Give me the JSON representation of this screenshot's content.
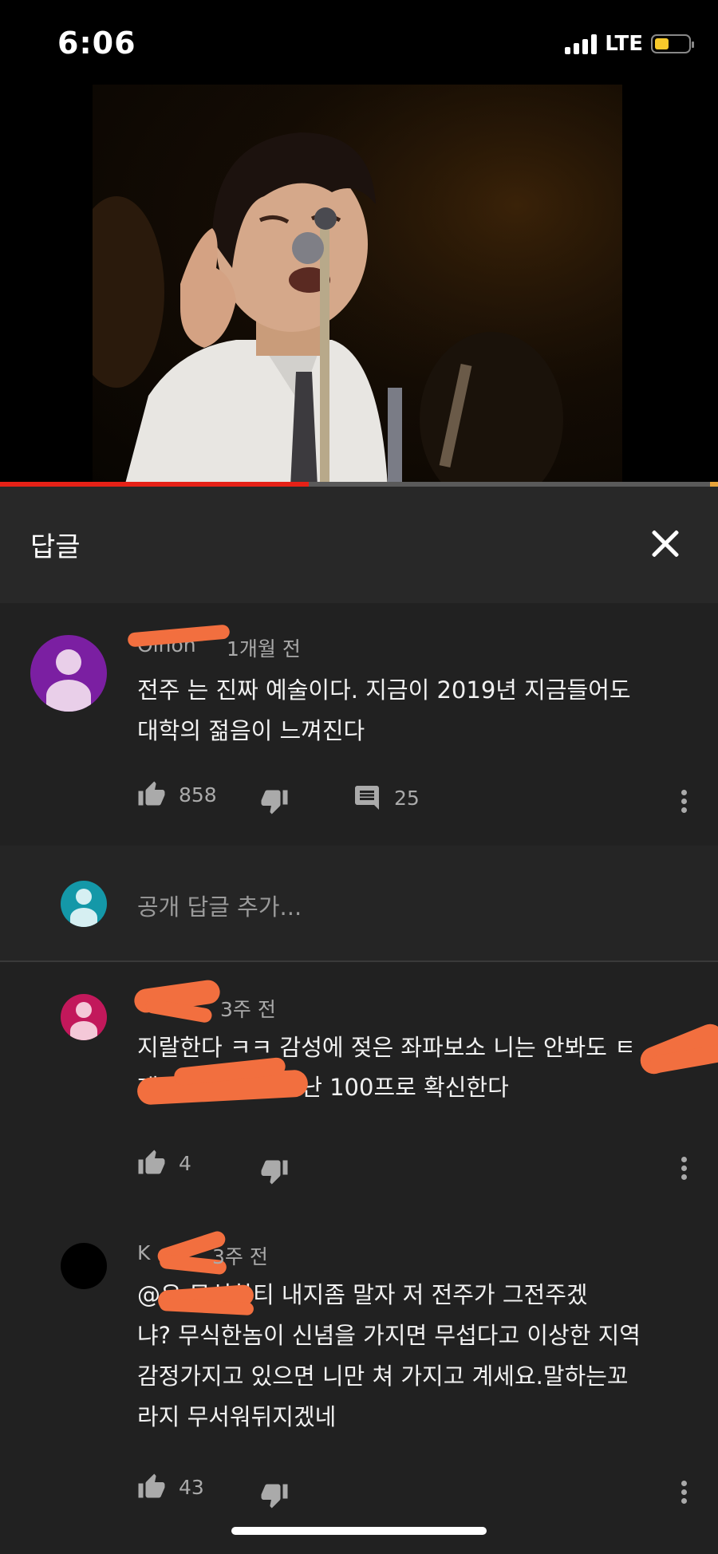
{
  "status_bar": {
    "time": "6:06",
    "network": "LTE"
  },
  "video": {
    "progress_fraction": 0.43
  },
  "panel": {
    "title": "답글"
  },
  "parent_comment": {
    "author": "Olhon",
    "time": "1개월 전",
    "text_line1": "전주 는 진짜 예술이다. 지금이 2019년 지금들어도",
    "text_line2": "대학의 젊음이 느껴진다",
    "likes": "858",
    "replies": "25",
    "avatar_color": "#7b1fa2"
  },
  "add_reply": {
    "placeholder": "공개 답글 추가..."
  },
  "replies": [
    {
      "author": "",
      "time": "3주 전",
      "text_line1": "지랄한다 ㅋㅋ 감성에 젖은 좌파보소 니는 안봐도 ㅌ",
      "text_line2": "재ㅊ                ㅡ새끼인걸 난 100프로 확신한다",
      "likes": "4",
      "avatar_color": "#c2185b"
    },
    {
      "author": "K",
      "time": "3주 전",
      "text_line1": "@유         무식한티 내지좀 말자 저 전주가 그전주겠",
      "text_line2": "냐? 무식한놈이 신념을 가지면 무섭다고 이상한 지역",
      "text_line3": "감정가지고 있으면 니만 쳐 가지고 계세요.말하는꼬",
      "text_line4": "라지 무서워뒤지겠네",
      "likes": "43",
      "avatar_color": "#000000"
    }
  ],
  "icons": [
    "thumb-up-icon",
    "thumb-down-icon",
    "comment-icon",
    "more-vert-icon",
    "close-icon"
  ]
}
